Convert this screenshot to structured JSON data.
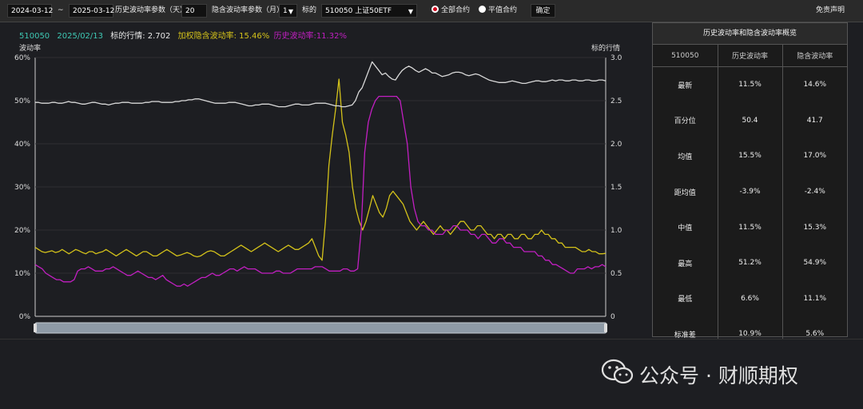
{
  "toolbar": {
    "start_date": "2024-03-12",
    "separator": "~",
    "end_date": "2025-03-12",
    "hv_param_label": "历史波动率参数（天）",
    "hv_param_value": "20",
    "iv_param_label": "隐含波动率参数（月）",
    "iv_param_value": "1",
    "underlying_label": "标的",
    "underlying_value": "510050 上证50ETF",
    "radio_all": "全部合约",
    "radio_atm": "平值合约",
    "confirm": "确定",
    "disclaimer": "免责声明"
  },
  "info": {
    "code": "510050",
    "date": "2025/02/13",
    "price_label": "标的行情: 2.702",
    "iv_label": "加权隐含波动率: 15.46%",
    "hv_label": "历史波动率:11.32%"
  },
  "colors": {
    "code": "#3ec8b4",
    "date": "#3ec8b4",
    "price": "#e8e8e8",
    "iv": "#d4c21a",
    "hv": "#c21fc2",
    "price_line": "#d9d9d9"
  },
  "table": {
    "title": "历史波动率和隐含波动率概览",
    "headers": [
      "510050",
      "历史波动率",
      "隐含波动率"
    ],
    "rows": [
      [
        "最新",
        "11.5%",
        "14.6%"
      ],
      [
        "百分位",
        "50.4",
        "41.7"
      ],
      [
        "均值",
        "15.5%",
        "17.0%"
      ],
      [
        "距均值",
        "-3.9%",
        "-2.4%"
      ],
      [
        "中值",
        "11.5%",
        "15.3%"
      ],
      [
        "最高",
        "51.2%",
        "54.9%"
      ],
      [
        "最低",
        "6.6%",
        "11.1%"
      ],
      [
        "标准差",
        "10.9%",
        "5.6%"
      ]
    ]
  },
  "watermark": "公众号 · 财顺期权",
  "chart_data": {
    "type": "line",
    "left_axis_label": "波动率",
    "right_axis_label": "标的行情",
    "left_ticks": [
      "0%",
      "10%",
      "20%",
      "30%",
      "40%",
      "50%",
      "60%"
    ],
    "right_ticks": [
      "0",
      "0.5",
      "1.0",
      "1.5",
      "2.0",
      "2.5",
      "3.0"
    ],
    "ylim_left": [
      0,
      60
    ],
    "ylim_right": [
      0,
      3.0
    ],
    "series": [
      {
        "name": "加权隐含波动率",
        "color": "#d4c21a",
        "axis": "left",
        "values": [
          16,
          15.5,
          15,
          14.8,
          15,
          15.2,
          14.8,
          15,
          15.5,
          15,
          14.5,
          15,
          15.5,
          15.2,
          14.8,
          14.5,
          15,
          15,
          14.5,
          14.8,
          15,
          15.5,
          15,
          14.5,
          14,
          14.5,
          15,
          15.5,
          15,
          14.5,
          14,
          14.5,
          15,
          15,
          14.5,
          14,
          14,
          14.5,
          15,
          15.5,
          15,
          14.5,
          14,
          14.2,
          14.5,
          14.8,
          14.5,
          14,
          13.8,
          14,
          14.5,
          15,
          15.2,
          15,
          14.5,
          14,
          14,
          14.5,
          15,
          15.5,
          16,
          16.5,
          16,
          15.5,
          15,
          15.5,
          16,
          16.5,
          17,
          16.5,
          16,
          15.5,
          15,
          15.5,
          16,
          16.5,
          16,
          15.5,
          15.5,
          16,
          16.5,
          17,
          18,
          16,
          14,
          13,
          22,
          35,
          42,
          48,
          55,
          45,
          42,
          38,
          30,
          25,
          22,
          20,
          22,
          25,
          28,
          26,
          24,
          23,
          25,
          28,
          29,
          28,
          27,
          26,
          24,
          22,
          21,
          20,
          21,
          22,
          21,
          20,
          19,
          20,
          21,
          20,
          20,
          19,
          20,
          21,
          22,
          22,
          21,
          20,
          20,
          21,
          21,
          20,
          19,
          19,
          18,
          19,
          19,
          18,
          19,
          19,
          18,
          18,
          19,
          19,
          18,
          18,
          19,
          19,
          20,
          19,
          19,
          18,
          18,
          17,
          17,
          16,
          16,
          16,
          16,
          15.5,
          15,
          15,
          15.5,
          15,
          15,
          14.5,
          14.5,
          14.6
        ]
      },
      {
        "name": "历史波动率",
        "color": "#c21fc2",
        "axis": "left",
        "values": [
          12,
          11.5,
          11,
          10,
          9.5,
          9,
          8.5,
          8.5,
          8,
          8,
          8,
          8.5,
          10.5,
          11,
          11,
          11.5,
          11,
          10.5,
          10.5,
          10.5,
          11,
          11,
          11.5,
          11,
          10.5,
          10,
          9.5,
          9.5,
          10,
          10.5,
          10,
          9.5,
          9,
          9,
          8.5,
          9,
          9.5,
          8.5,
          8,
          7.5,
          7,
          7,
          7.5,
          7,
          7.5,
          8,
          8.5,
          9,
          9,
          9.5,
          10,
          9.5,
          9.5,
          10,
          10.5,
          11,
          11,
          10.5,
          11,
          11.5,
          11,
          11,
          11,
          10.5,
          10,
          10,
          10,
          10,
          10.5,
          10.5,
          10,
          10,
          10,
          10.5,
          11,
          11,
          11,
          11,
          11,
          11.5,
          11.5,
          11.5,
          11,
          10.5,
          10.5,
          10.5,
          10.5,
          11,
          11,
          10.5,
          10.5,
          11,
          20,
          38,
          45,
          48,
          50,
          51,
          51,
          51,
          51,
          51,
          51,
          50,
          45,
          40,
          30,
          25,
          22,
          21,
          21,
          20,
          20,
          19,
          19,
          19,
          20,
          20,
          21,
          21,
          20,
          20,
          20,
          19,
          19,
          18,
          19,
          19,
          18,
          17,
          17,
          18,
          18,
          17,
          17,
          16,
          16,
          16,
          15,
          15,
          15,
          15,
          14,
          14,
          13,
          13,
          12,
          12,
          11.5,
          11,
          10.5,
          10,
          10,
          11,
          11,
          11,
          11.5,
          11,
          11.5,
          11.5,
          12,
          11.5
        ]
      },
      {
        "name": "标的行情",
        "color": "#d9d9d9",
        "axis": "right",
        "values": [
          2.48,
          2.48,
          2.47,
          2.47,
          2.47,
          2.48,
          2.48,
          2.47,
          2.47,
          2.48,
          2.49,
          2.48,
          2.48,
          2.47,
          2.46,
          2.46,
          2.47,
          2.48,
          2.48,
          2.47,
          2.46,
          2.46,
          2.45,
          2.46,
          2.47,
          2.47,
          2.48,
          2.48,
          2.48,
          2.47,
          2.47,
          2.47,
          2.47,
          2.48,
          2.48,
          2.49,
          2.49,
          2.49,
          2.48,
          2.48,
          2.48,
          2.48,
          2.49,
          2.49,
          2.5,
          2.5,
          2.51,
          2.51,
          2.52,
          2.52,
          2.51,
          2.5,
          2.49,
          2.48,
          2.47,
          2.47,
          2.47,
          2.47,
          2.48,
          2.48,
          2.48,
          2.47,
          2.46,
          2.45,
          2.44,
          2.44,
          2.45,
          2.45,
          2.46,
          2.46,
          2.46,
          2.45,
          2.44,
          2.43,
          2.43,
          2.43,
          2.44,
          2.45,
          2.46,
          2.46,
          2.45,
          2.45,
          2.45,
          2.46,
          2.47,
          2.47,
          2.47,
          2.47,
          2.46,
          2.45,
          2.44,
          2.44,
          2.43,
          2.43,
          2.44,
          2.45,
          2.5,
          2.6,
          2.65,
          2.75,
          2.85,
          2.95,
          2.9,
          2.85,
          2.8,
          2.82,
          2.78,
          2.75,
          2.74,
          2.8,
          2.85,
          2.88,
          2.9,
          2.88,
          2.85,
          2.83,
          2.85,
          2.87,
          2.85,
          2.82,
          2.82,
          2.8,
          2.78,
          2.79,
          2.8,
          2.82,
          2.83,
          2.83,
          2.82,
          2.8,
          2.79,
          2.8,
          2.81,
          2.8,
          2.78,
          2.76,
          2.74,
          2.73,
          2.72,
          2.71,
          2.71,
          2.71,
          2.72,
          2.73,
          2.72,
          2.71,
          2.7,
          2.7,
          2.71,
          2.72,
          2.73,
          2.73,
          2.72,
          2.72,
          2.73,
          2.74,
          2.73,
          2.74,
          2.74,
          2.73,
          2.73,
          2.74,
          2.74,
          2.73,
          2.73,
          2.74,
          2.74,
          2.73,
          2.73,
          2.74,
          2.74,
          2.73
        ]
      }
    ]
  }
}
